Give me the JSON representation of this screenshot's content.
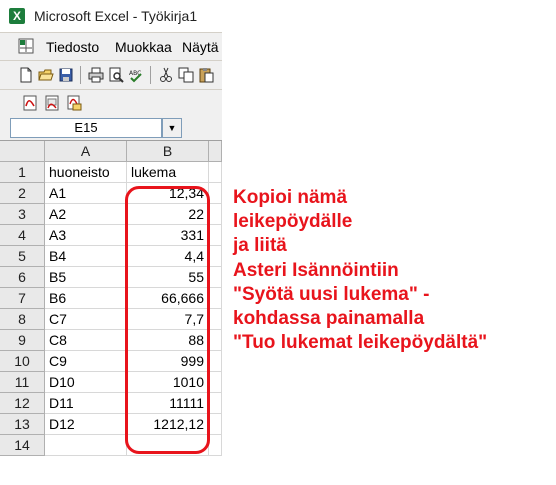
{
  "window": {
    "title": "Microsoft Excel - Työkirja1",
    "app_icon_glyph": "X"
  },
  "menu": {
    "items": [
      "Tiedosto",
      "Muokkaa",
      "Näytä"
    ]
  },
  "toolbar": {
    "standard_icons": [
      "new-file-icon",
      "open-folder-icon",
      "save-icon",
      "print-icon",
      "print-preview-icon",
      "spelling-icon",
      "cut-icon",
      "copy-icon",
      "paste-icon"
    ],
    "pdf_icons": [
      "pdf-icon",
      "pdf-convert-icon",
      "pdf-mail-icon"
    ]
  },
  "name_box": {
    "value": "E15",
    "dropdown_glyph": "▼"
  },
  "sheet": {
    "columns": [
      "A",
      "B"
    ],
    "rows": [
      {
        "n": "1",
        "a": "huoneisto",
        "b": "lukema"
      },
      {
        "n": "2",
        "a": "A1",
        "b": "12,34"
      },
      {
        "n": "3",
        "a": "A2",
        "b": "22"
      },
      {
        "n": "4",
        "a": "A3",
        "b": "331"
      },
      {
        "n": "5",
        "a": "B4",
        "b": "4,4"
      },
      {
        "n": "6",
        "a": "B5",
        "b": "55"
      },
      {
        "n": "7",
        "a": "B6",
        "b": "66,666"
      },
      {
        "n": "8",
        "a": "C7",
        "b": "7,7"
      },
      {
        "n": "9",
        "a": "C8",
        "b": "88"
      },
      {
        "n": "10",
        "a": "C9",
        "b": "999"
      },
      {
        "n": "11",
        "a": "D10",
        "b": "1010"
      },
      {
        "n": "12",
        "a": "D11",
        "b": "11111"
      },
      {
        "n": "13",
        "a": "D12",
        "b": "1212,12"
      },
      {
        "n": "14",
        "a": "",
        "b": ""
      }
    ]
  },
  "annotation": {
    "color": "#e8141c",
    "lines": [
      "Kopioi nämä",
      "leikepöydälle",
      "ja liitä",
      "Asteri Isännöintiin",
      "\"Syötä uusi lukema\" -",
      "kohdassa painamalla",
      "\"Tuo lukemat leikepöydältä\""
    ]
  }
}
